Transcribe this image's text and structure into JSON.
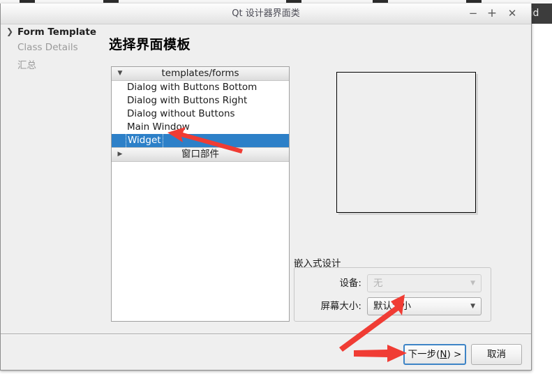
{
  "background": {
    "side_panel_text": "oid"
  },
  "window": {
    "title": "Qt 设计器界面类",
    "controls": {
      "minimize": "−",
      "maximize": "+",
      "close": "✕"
    }
  },
  "sidebar": {
    "items": [
      {
        "label": "Form Template",
        "state": "active",
        "chevron": "chevron-right-icon"
      },
      {
        "label": "Class Details",
        "state": "disabled"
      },
      {
        "label": "汇总",
        "state": "disabled"
      }
    ]
  },
  "main": {
    "page_title": "选择界面模板",
    "template_tree": {
      "groups": [
        {
          "label": "templates/forms",
          "expanded": true,
          "triangle": "triangle-down-icon",
          "items": [
            {
              "label": "Dialog with Buttons Bottom",
              "selected": false
            },
            {
              "label": "Dialog with Buttons Right",
              "selected": false
            },
            {
              "label": "Dialog without Buttons",
              "selected": false
            },
            {
              "label": "Main Window",
              "selected": false
            },
            {
              "label": "Widget",
              "selected": true
            }
          ]
        },
        {
          "label": "窗口部件",
          "expanded": false,
          "triangle": "triangle-right-icon",
          "items": []
        }
      ]
    },
    "preview": {
      "name": "form-preview-box"
    },
    "embedded_design": {
      "group_label": "嵌入式设计",
      "fields": [
        {
          "label": "设备：",
          "label_text": "设备:",
          "value": "无",
          "disabled": true,
          "arrow": "chevron-down-icon"
        },
        {
          "label": "屏幕大小：",
          "label_text": "屏幕大小:",
          "value": "默认大小",
          "disabled": false,
          "arrow": "chevron-down-icon"
        }
      ]
    }
  },
  "footer": {
    "next_label_prefix": "下一步(",
    "next_accel": "N",
    "next_label_suffix": ") >",
    "next_label": "下一步(N) >",
    "cancel_label": "取消"
  },
  "annotations": {
    "arrows": [
      {
        "name": "arrow-to-widget-item",
        "target": "Widget",
        "color": "#f03c34"
      },
      {
        "name": "arrow-to-screen-size-combo",
        "target": "默认大小",
        "color": "#f03c34"
      },
      {
        "name": "arrow-to-next-button",
        "target": "下一步(N) >",
        "color": "#f03c34"
      }
    ]
  },
  "colors": {
    "selection_blue": "#2d80c8",
    "annotation_red": "#f03c34",
    "dialog_bg": "#efefef",
    "default_button_border": "#3d84c6"
  }
}
